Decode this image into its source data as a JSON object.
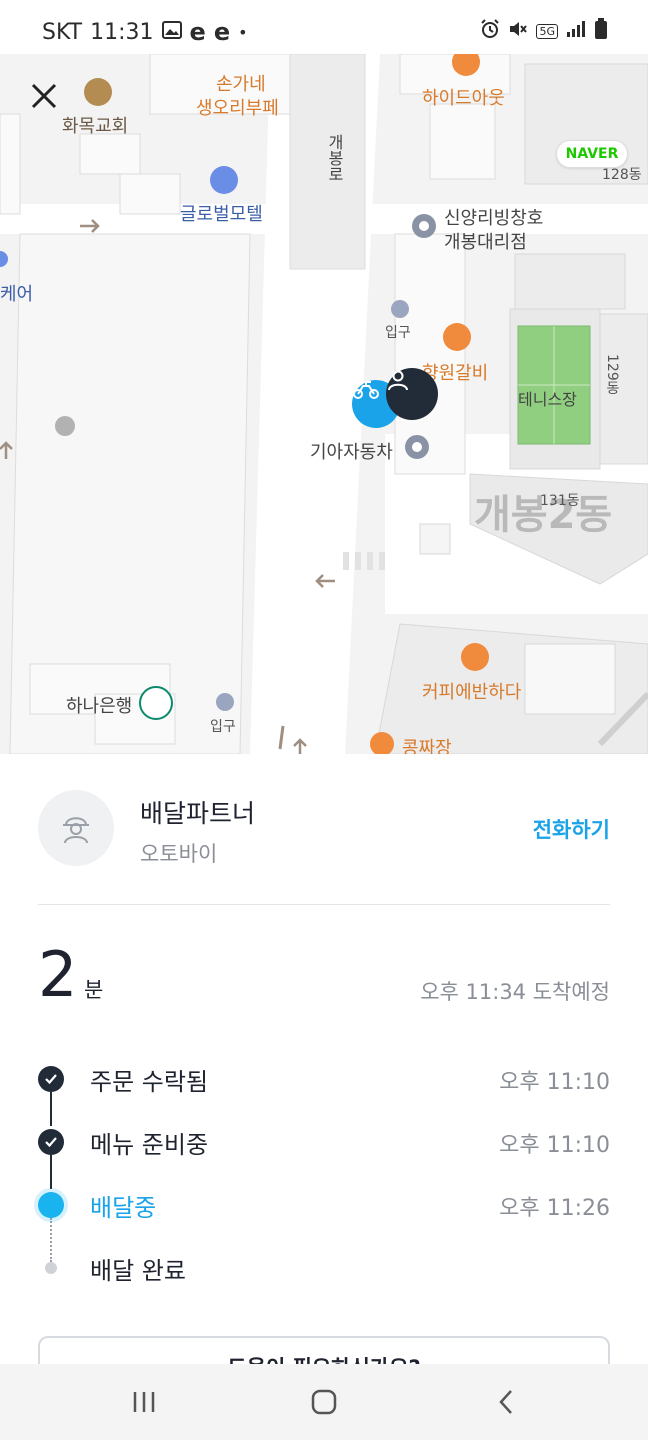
{
  "status_bar": {
    "carrier": "SKT",
    "time": "11:31",
    "network": "5G",
    "icons": [
      "gallery-icon",
      "e-app-icon",
      "e-app-icon",
      "dot-icon",
      "alarm-icon",
      "mute-icon",
      "signal-icon",
      "battery-icon"
    ]
  },
  "map": {
    "labels": {
      "church": "화목교회",
      "buffet_line1": "손가네",
      "buffet_line2": "생오리부페",
      "hideout": "하이드아웃",
      "motel": "글로벌모텔",
      "street": "개봉로",
      "shop_line1": "신양리빙창호",
      "shop_line2": "개봉대리점",
      "entrance1": "입구",
      "galbi": "향원갈비",
      "tennis": "테니스장",
      "kia": "기아자동차",
      "district": "개봉2동",
      "bldg129": "129동",
      "bldg131": "131동",
      "bldg128": "128동",
      "care": "케어",
      "hana": "하나은행",
      "entrance2": "입구",
      "coffee": "커피에반하다",
      "kongjjajang": "콩짜장"
    },
    "naver_logo": "NAVER"
  },
  "partner": {
    "name": "배달파트너",
    "vehicle": "오토바이",
    "call_label": "전화하기"
  },
  "eta": {
    "minutes": "2",
    "unit": "분",
    "arrival": "오후 11:34 도착예정"
  },
  "steps": [
    {
      "label": "주문 수락됨",
      "time": "오후 11:10",
      "state": "done"
    },
    {
      "label": "메뉴 준비중",
      "time": "오후 11:10",
      "state": "done"
    },
    {
      "label": "배달중",
      "time": "오후 11:26",
      "state": "active"
    },
    {
      "label": "배달 완료",
      "time": "",
      "state": "pending"
    }
  ],
  "help_button": "도움이 필요하신가요?",
  "colors": {
    "accent": "#1aa3e8",
    "dark": "#222b38",
    "muted": "#8a8e96"
  }
}
